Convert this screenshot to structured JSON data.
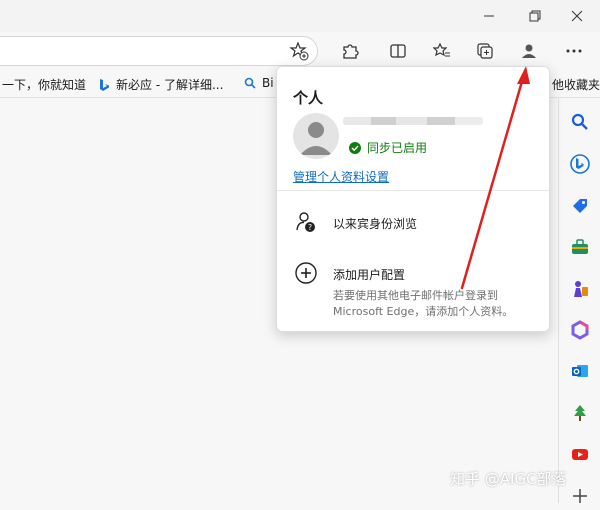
{
  "favorites_bar": {
    "items": [
      {
        "label": "一下，你就知道"
      },
      {
        "label": "新必应 - 了解详细..."
      },
      {
        "label": "Bi"
      },
      {
        "label": "他收藏夹"
      }
    ]
  },
  "profile_panel": {
    "title": "个人",
    "sync_status": "同步已启用",
    "manage_link": "管理个人资料设置",
    "guest_label": "以来宾身份浏览",
    "add_profile_label": "添加用户配置",
    "add_profile_description": "若要使用其他电子邮件帐户登录到 Microsoft Edge，请添加个人资料。"
  },
  "watermark": "知乎 @AIGC部落",
  "colors": {
    "sync_green": "#107c10",
    "link_blue": "#0f6cbd",
    "annotation_red": "#e02020"
  },
  "icons": {
    "sidebar": [
      "search-icon",
      "bing-copilot-icon",
      "shopping-tag-icon",
      "tools-icon",
      "games-icon",
      "office-icon",
      "outlook-icon",
      "tree-icon",
      "youtube-icon",
      "add-icon"
    ]
  }
}
